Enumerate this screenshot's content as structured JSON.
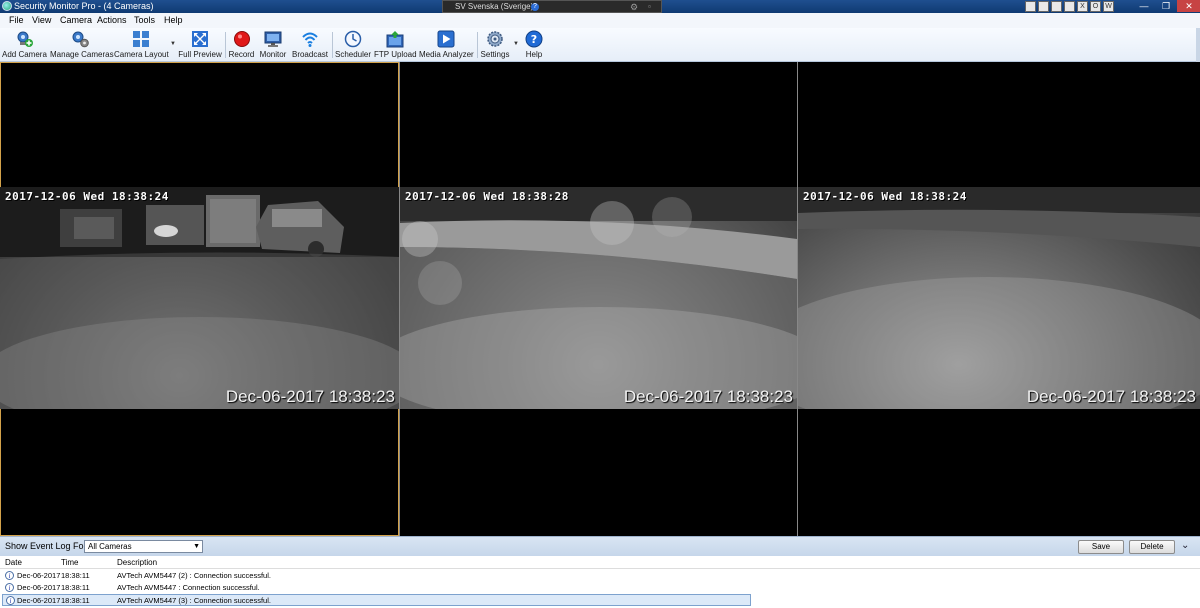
{
  "window": {
    "title": "Security Monitor Pro - (4 Cameras)",
    "language_bar": "SV Svenska (Sverige)",
    "tray_icons": [
      "",
      "",
      "",
      "",
      "X",
      "O",
      "W"
    ],
    "controls": [
      "—",
      "❐",
      "✕"
    ]
  },
  "menu": [
    "File",
    "View",
    "Camera",
    "Actions",
    "Tools",
    "Help"
  ],
  "toolbar": {
    "add_camera": "Add Camera",
    "manage_cameras": "Manage Cameras",
    "camera_layout": "Camera Layout",
    "full_preview": "Full Preview",
    "record": "Record",
    "monitor": "Monitor",
    "broadcast": "Broadcast",
    "scheduler": "Scheduler",
    "ftp_upload": "FTP Upload",
    "media_analyzer": "Media Analyzer",
    "settings": "Settings",
    "help": "Help"
  },
  "cameras": [
    {
      "osd_top": "2017-12-06 Wed 18:38:24",
      "osd_bottom": "Dec-06-2017 18:38:23",
      "selected": true
    },
    {
      "osd_top": "2017-12-06 Wed 18:38:28",
      "osd_bottom": "Dec-06-2017 18:38:23",
      "selected": false
    },
    {
      "osd_top": "2017-12-06 Wed 18:38:24",
      "osd_bottom": "Dec-06-2017 18:38:23",
      "selected": false
    }
  ],
  "event_log": {
    "label": "Show Event Log For:",
    "filter_value": "All Cameras",
    "save_label": "Save",
    "delete_label": "Delete",
    "columns": {
      "date": "Date",
      "time": "Time",
      "description": "Description"
    },
    "rows": [
      {
        "date": "Dec-06-2017",
        "time": "18:38:11",
        "description": "AVTech AVM5447 (2) : Connection successful."
      },
      {
        "date": "Dec-06-2017",
        "time": "18:38:11",
        "description": "AVTech AVM5447 : Connection successful."
      },
      {
        "date": "Dec-06-2017",
        "time": "18:38:11",
        "description": "AVTech AVM5447 (3) : Connection successful."
      }
    ]
  },
  "colors": {
    "selection_outline": "#d3a24a",
    "titlebar": "#1f4f8f",
    "record_red": "#e01818"
  }
}
